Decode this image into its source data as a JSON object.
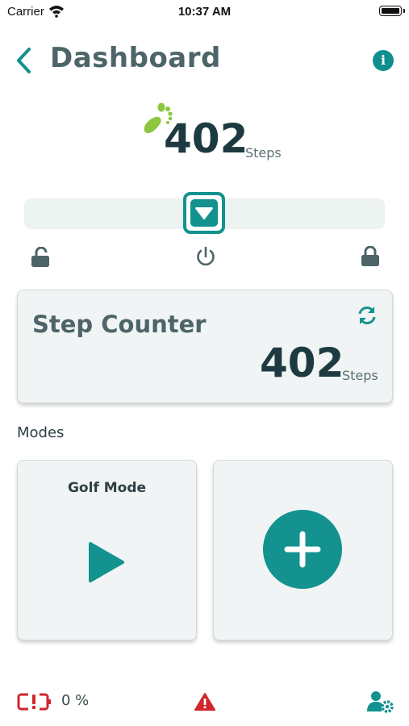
{
  "status_bar": {
    "carrier": "Carrier",
    "time": "10:37 AM"
  },
  "header": {
    "title": "Dashboard",
    "back_icon": "chevron-left-icon",
    "info_icon": "info-icon",
    "info_glyph": "i"
  },
  "summary": {
    "steps": "402",
    "unit": "Steps",
    "icon": "footprint-icon"
  },
  "slider": {
    "left_icon": "unlock-icon",
    "center_icon": "power-icon",
    "right_icon": "lock-icon"
  },
  "step_counter": {
    "title": "Step Counter",
    "steps": "402",
    "unit": "Steps",
    "refresh_icon": "refresh-icon"
  },
  "modes": {
    "label": "Modes",
    "items": [
      {
        "label": "Golf Mode",
        "icon": "play-icon"
      }
    ],
    "add_icon": "plus-icon"
  },
  "footer": {
    "battery_percent": "0 %",
    "battery_icon": "battery-empty-icon",
    "warning_icon": "warning-icon",
    "settings_icon": "user-settings-icon"
  },
  "colors": {
    "accent": "#13928f",
    "title": "#4d6468",
    "dark_text": "#1d3a41",
    "alert": "#d0262c",
    "footprint": "#8dc63f"
  }
}
